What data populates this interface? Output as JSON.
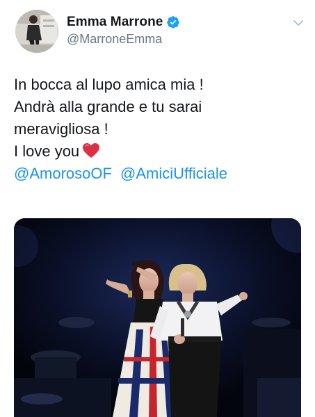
{
  "author": {
    "display_name": "Emma Marrone",
    "handle": "@MarroneEmma",
    "verified": true,
    "avatar_icon": "profile-photo",
    "verified_icon": "verified-badge-icon"
  },
  "tweet": {
    "lines": [
      "In bocca al lupo amica mia !",
      "Andrà alla grande e tu sarai",
      "meravigliosa !",
      "I love you"
    ],
    "emoji": "red-heart",
    "mentions": [
      "@AmorosoOF",
      "@AmiciUfficiale"
    ]
  },
  "media": {
    "type": "photo",
    "description_icon": "concert-photo"
  },
  "colors": {
    "text": "#14171a",
    "secondary": "#657786",
    "link": "#1b95e0",
    "verified": "#1da1f2",
    "heart": "#e0245e"
  }
}
